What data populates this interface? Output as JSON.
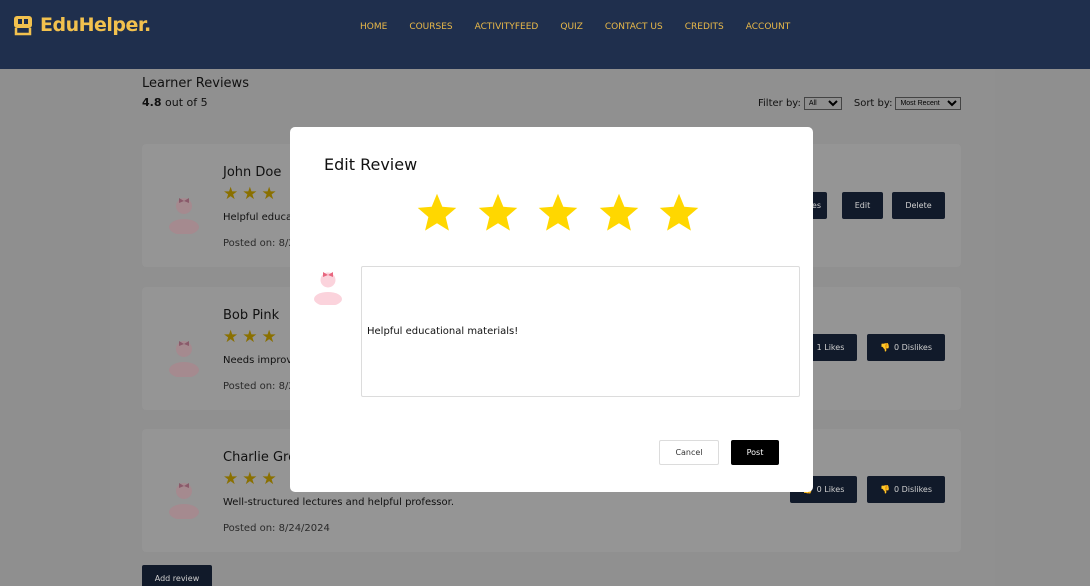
{
  "brand": {
    "name": "EduHelper."
  },
  "nav": {
    "items": [
      "HOME",
      "COURSES",
      "ACTIVITYFEED",
      "QUIZ",
      "CONTACT US",
      "CREDITS",
      "ACCOUNT"
    ]
  },
  "reviews": {
    "title": "Learner Reviews",
    "score": "4.8",
    "score_suffix": " out of 5",
    "filter_label": "Filter by:",
    "filter_value": "All",
    "sort_label": "Sort by:",
    "sort_value": "Most Recent",
    "add_review_label": "Add review",
    "cards": [
      {
        "name": "John Doe",
        "text": "Helpful educat",
        "date": "Posted on: 8/2",
        "buttons": [
          "es",
          "Edit",
          "Delete"
        ]
      },
      {
        "name": "Bob Pink",
        "text": "Needs improv",
        "date": "Posted on: 8/2",
        "buttons": [
          "1 Likes",
          "0 Dislikes"
        ]
      },
      {
        "name": "Charlie Gre",
        "text": "Well-structured lectures and helpful professor.",
        "date": "Posted on: 8/24/2024",
        "buttons": [
          "0 Likes",
          "0 Dislikes"
        ]
      }
    ]
  },
  "modal": {
    "title": "Edit Review",
    "rating": 5,
    "review_text": "Helpful educational materials!",
    "cancel_label": "Cancel",
    "post_label": "Post"
  },
  "colors": {
    "navbar": "#1f2f4d",
    "nav_text": "#e9b949",
    "star": "#ffd700",
    "button_dark": "#111a2a"
  }
}
